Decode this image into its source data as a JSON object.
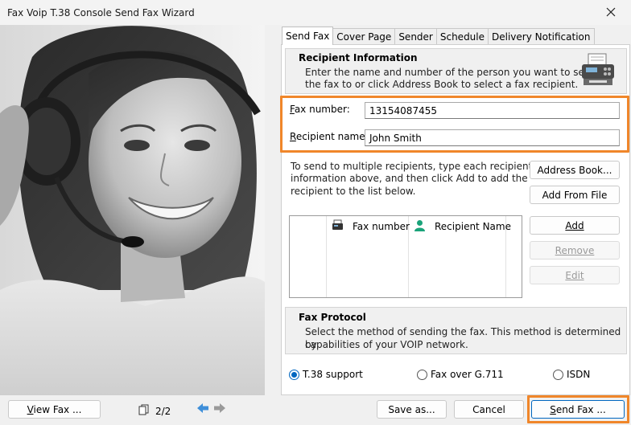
{
  "window": {
    "title": "Fax Voip T.38 Console Send Fax Wizard"
  },
  "tabs": [
    {
      "label": "Send Fax",
      "active": true
    },
    {
      "label": "Cover Page"
    },
    {
      "label": "Sender"
    },
    {
      "label": "Schedule"
    },
    {
      "label": "Delivery Notification"
    }
  ],
  "recipient_info": {
    "heading": "Recipient Information",
    "desc_line1": "Enter the name and number of the person you want to send",
    "desc_line2": "the fax to or click Address Book to select a fax recipient."
  },
  "fields": {
    "fax_number": {
      "label_key": "F",
      "label_rest": "ax number:",
      "value": "13154087455"
    },
    "recipient_name": {
      "label_key": "R",
      "label_rest": "ecipient name:",
      "value": "John Smith"
    }
  },
  "multi": {
    "line1": "To send to multiple recipients, type each recipient's",
    "line2": "information above, and then click Add to add the",
    "line3": "recipient to the list below."
  },
  "buttons": {
    "address_book": "Address Book...",
    "add_from_file": "Add From File",
    "add": "Add",
    "remove": "Remove",
    "edit": "Edit",
    "view_fax": "View Fax ...",
    "save_as": "Save as...",
    "cancel": "Cancel",
    "send_fax": "Send Fax ..."
  },
  "recipient_list": {
    "columns": [
      "Fax number",
      "Recipient Name"
    ]
  },
  "fax_protocol": {
    "heading": "Fax Protocol",
    "desc_line1": "Select the method of sending the fax. This method is determined by",
    "desc_line2": "capabilities of your VOIP network.",
    "options": [
      {
        "label": "T.38 support",
        "checked": true
      },
      {
        "label": "Fax over G.711",
        "checked": false
      },
      {
        "label": "ISDN",
        "checked": false
      }
    ]
  },
  "pager": {
    "text": "2/2"
  },
  "colors": {
    "highlight": "#f0862a",
    "accent": "#0067c0"
  }
}
